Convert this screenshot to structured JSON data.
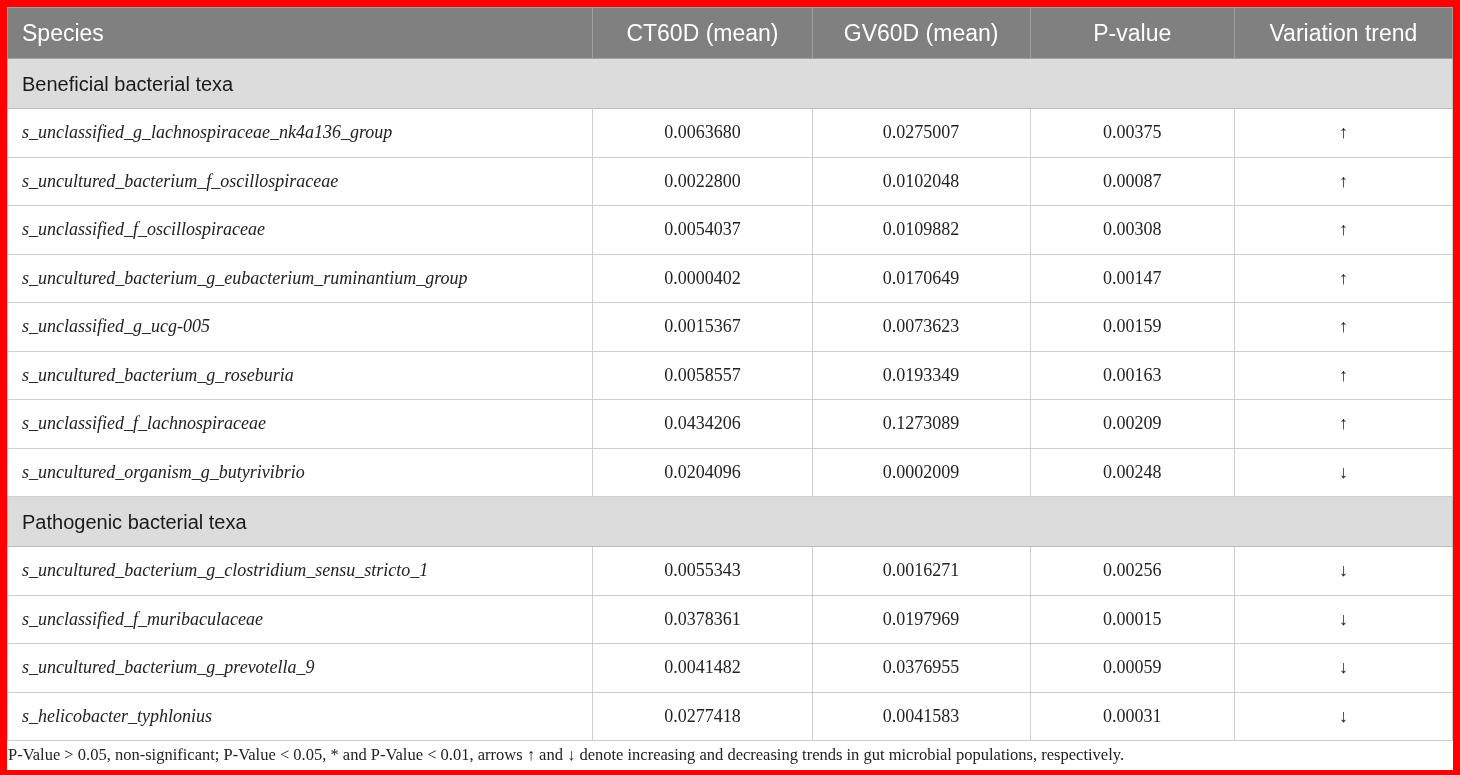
{
  "table": {
    "columns": [
      "Species",
      "CT60D (mean)",
      "GV60D (mean)",
      "P-value",
      "Variation trend"
    ],
    "groups": [
      {
        "title": "Beneficial bacterial texa",
        "rows": [
          [
            "s_unclassified_g_lachnospiraceae_nk4a136_group",
            "0.0063680",
            "0.0275007",
            "0.00375",
            "↑"
          ],
          [
            "s_uncultured_bacterium_f_oscillospiraceae",
            "0.0022800",
            "0.0102048",
            "0.00087",
            "↑"
          ],
          [
            "s_unclassified_f_oscillospiraceae",
            "0.0054037",
            "0.0109882",
            "0.00308",
            "↑"
          ],
          [
            "s_uncultured_bacterium_g_eubacterium_ruminantium_group",
            "0.0000402",
            "0.0170649",
            "0.00147",
            "↑"
          ],
          [
            "s_unclassified_g_ucg-005",
            "0.0015367",
            "0.0073623",
            "0.00159",
            "↑"
          ],
          [
            "s_uncultured_bacterium_g_roseburia",
            "0.0058557",
            "0.0193349",
            "0.00163",
            "↑"
          ],
          [
            "s_unclassified_f_lachnospiraceae",
            "0.0434206",
            "0.1273089",
            "0.00209",
            "↑"
          ],
          [
            "s_uncultured_organism_g_butyrivibrio",
            "0.0204096",
            "0.0002009",
            "0.00248",
            "↓"
          ]
        ]
      },
      {
        "title": "Pathogenic bacterial texa",
        "rows": [
          [
            "s_uncultured_bacterium_g_clostridium_sensu_stricto_1",
            "0.0055343",
            "0.0016271",
            "0.00256",
            "↓"
          ],
          [
            "s_unclassified_f_muribaculaceae",
            "0.0378361",
            "0.0197969",
            "0.00015",
            "↓"
          ],
          [
            "s_uncultured_bacterium_g_prevotella_9",
            "0.0041482",
            "0.0376955",
            "0.00059",
            "↓"
          ],
          [
            "s_helicobacter_typhlonius",
            "0.0277418",
            "0.0041583",
            "0.00031",
            "↓"
          ]
        ]
      }
    ]
  },
  "footnote": "P-Value > 0.05, non-significant; P-Value < 0.05, * and P-Value < 0.01, arrows ↑ and ↓ denote increasing and decreasing trends in gut microbial populations, respectively."
}
